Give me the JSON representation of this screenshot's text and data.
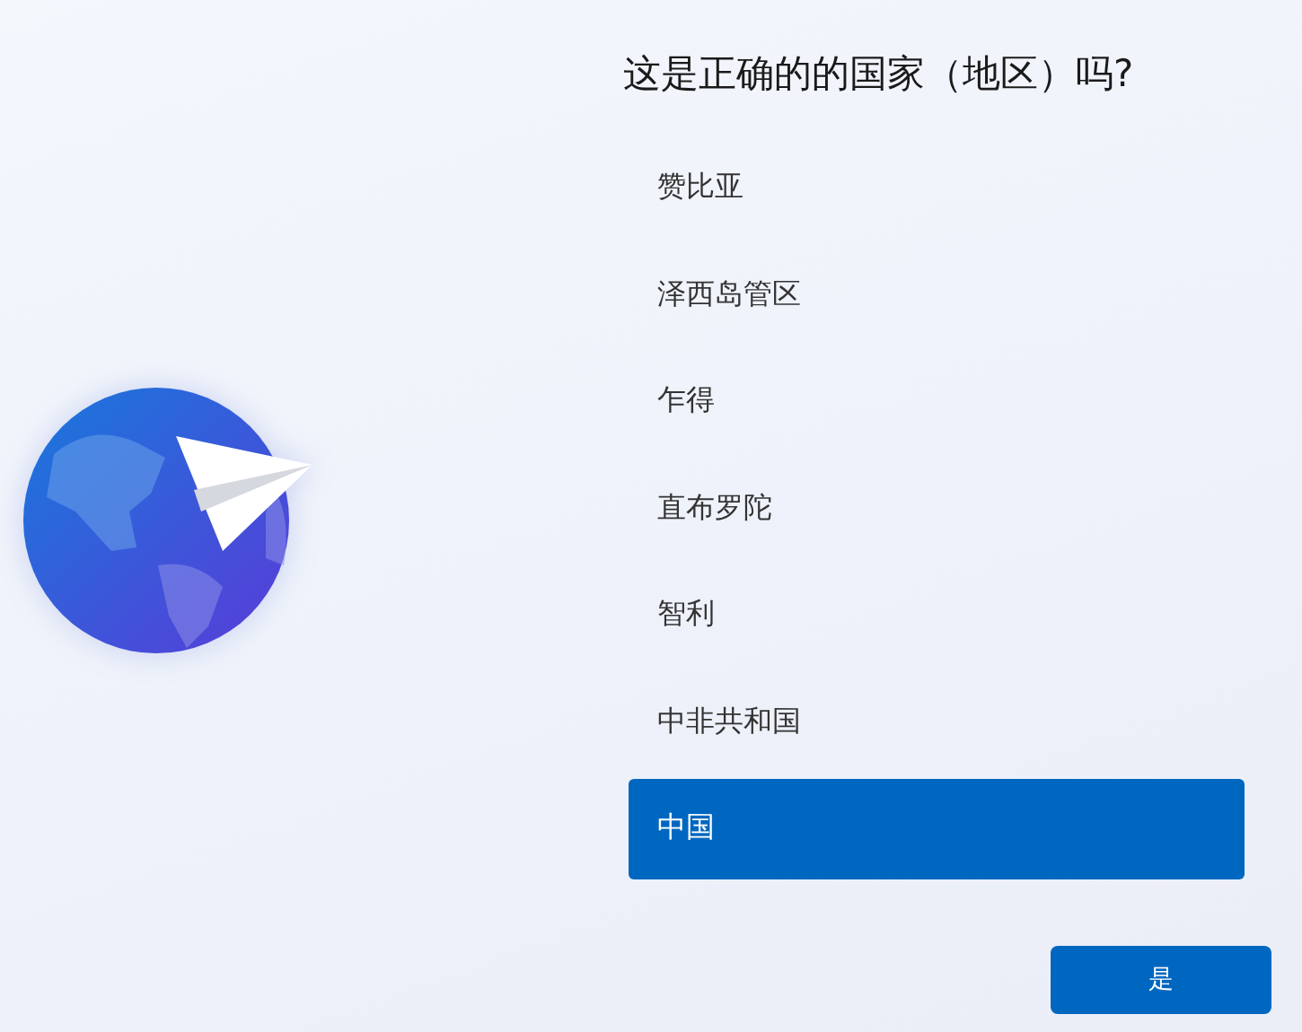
{
  "title": "这是正确的的国家（地区）吗?",
  "regions": [
    {
      "label": "赞比亚",
      "selected": false
    },
    {
      "label": "泽西岛管区",
      "selected": false
    },
    {
      "label": "乍得",
      "selected": false
    },
    {
      "label": "直布罗陀",
      "selected": false
    },
    {
      "label": "智利",
      "selected": false
    },
    {
      "label": "中非共和国",
      "selected": false
    },
    {
      "label": "中国",
      "selected": true
    }
  ],
  "buttons": [
    {
      "label": "是"
    }
  ]
}
